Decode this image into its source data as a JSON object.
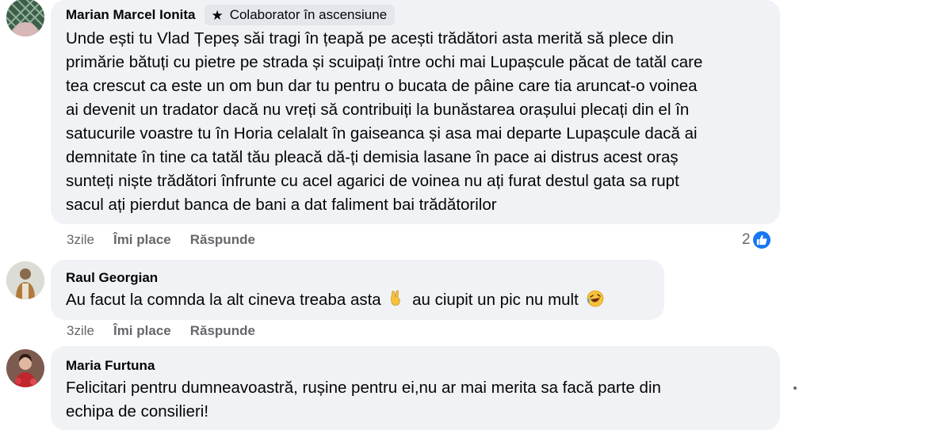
{
  "comments": [
    {
      "author": "Marian Marcel Ionita",
      "badge": "Colaborator în ascensiune",
      "lines": [
        "Unde ești tu Vlad Țepeș săi tragi în țeapă pe acești trădători asta merită să plece din",
        "primărie bătuți cu pietre pe strada și scuipați între ochi mai Lupașcule păcat de tatăl care",
        "tea crescut ca este un om bun dar tu pentru o bucata de pâine care tia aruncat-o voinea",
        "ai devenit un tradator dacă nu vreți să contribuiți la bunăstarea orașului plecați din el în",
        "satucurile voastre tu în Horia celalalt în gaiseanca și asa mai departe Lupașcule dacă ai",
        "demnitate în tine ca tatăl tău pleacă dă-ți demisia lasane în pace ai distrus acest oraș",
        "sunteți niște trădători înfrunte cu acel agarici de voinea nu ați furat destul gata sa rupt",
        "sacul ați pierdut banca de bani a dat faliment bai trădătorilor"
      ],
      "time": "3zile",
      "like_label": "Îmi place",
      "reply_label": "Răspunde",
      "reaction_count": "2"
    },
    {
      "author": "Raul Georgian",
      "text_part1": "Au facut la comnda la alt cineva treaba asta",
      "emoji1": "victory-hand",
      "text_part2": "au ciupit un pic nu mult",
      "emoji2": "rolling-laughing",
      "time": "3zile",
      "like_label": "Îmi place",
      "reply_label": "Răspunde"
    },
    {
      "author": "Maria Furtuna",
      "lines": [
        "Felicitari pentru dumneavoastră, rușine pentru ei,nu ar mai merita sa facă parte din",
        "echipa de consilieri!"
      ]
    }
  ],
  "colors": {
    "bubble": "#f0f2f5",
    "badge": "#e4e6eb",
    "secondary_text": "#65676b",
    "like_blue": "#1877f2"
  }
}
